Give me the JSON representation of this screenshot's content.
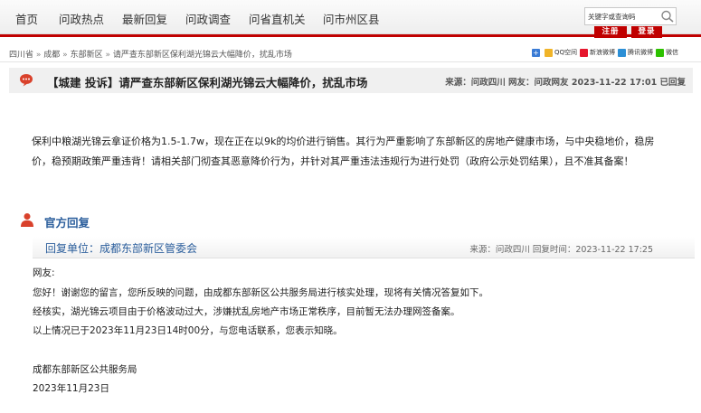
{
  "nav": {
    "items": [
      "首页",
      "问政热点",
      "最新回复",
      "问政调查",
      "问省直机关",
      "问市州区县"
    ],
    "search_placeholder": "关键字或查询码",
    "register_label": "注册",
    "login_label": "登录"
  },
  "breadcrumb": {
    "items": [
      "四川省",
      "成都",
      "东部新区",
      "请严查东部新区保利湖光锦云大幅降价，扰乱市场"
    ],
    "separator": "»"
  },
  "share": {
    "items": [
      {
        "label": "",
        "icon": "plus-icon",
        "color": "#3a7bd5"
      },
      {
        "label": "QQ空间",
        "icon": "qzone-icon",
        "color": "#f0b429"
      },
      {
        "label": "新浪微博",
        "icon": "weibo-icon",
        "color": "#e6162d"
      },
      {
        "label": "腾讯微博",
        "icon": "tencent-weibo-icon",
        "color": "#2c8fd6"
      },
      {
        "label": "微信",
        "icon": "wechat-icon",
        "color": "#2dc100"
      }
    ]
  },
  "post": {
    "title": "【城建 投诉】请严查东部新区保利湖光锦云大幅降价，扰乱市场",
    "meta": "来源：问政四川 网友：问政网友 2023-11-22 17:01 已回复",
    "content_lines": [
      "保利中粮湖光锦云拿证价格为1.5-1.7w，现在正在以9k的均价进行销售。其行为严重影响了东部新区的房地产健康市场，与中央稳地价，稳房",
      "价，稳预期政策严重违背！请相关部门彻查其恶意降价行为，并针对其严重违法违规行为进行处罚（政府公示处罚结果），且不准其备案！"
    ]
  },
  "reply": {
    "heading": "官方回复",
    "unit": "回复单位：成都东部新区管委会",
    "meta": "来源：问政四川 回复时间：2023-11-22 17:25",
    "lines": [
      "网友:",
      "您好！谢谢您的留言，您所反映的问题，由成都东部新区公共服务局进行核实处理，现将有关情况答复如下。",
      "经核实，湖光锦云项目由于价格波动过大，涉嫌扰乱房地产市场正常秩序，目前暂无法办理网签备案。",
      "以上情况已于2023年11月23日14时00分，与您电话联系，您表示知晓。",
      "",
      "成都东部新区公共服务局",
      "2023年11月23日"
    ]
  },
  "colors": {
    "accent_red": "#c00000",
    "reply_blue": "#2b5e9c",
    "bubble_red": "#d9412b"
  }
}
